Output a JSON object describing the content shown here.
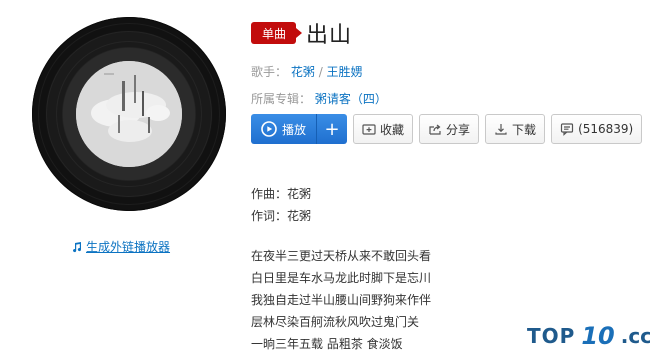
{
  "song": {
    "badge": "单曲",
    "title": "出山",
    "singer_label": "歌手：",
    "singers": [
      "花粥",
      "王胜娚"
    ],
    "album_label": "所属专辑：",
    "album": "粥请客（四）"
  },
  "actions": {
    "play": "播放",
    "add": "+",
    "collect": "收藏",
    "share": "分享",
    "download": "下载",
    "comments": "(516839)"
  },
  "left": {
    "player_link": "生成外链播放器"
  },
  "lyrics": {
    "composer": "作曲：花粥",
    "lyricist": "作词：花粥",
    "lines": [
      "在夜半三更过天桥从来不敢回头看",
      "白日里是车水马龙此时脚下是忘川",
      "我独自走过半山腰山间野狗来作伴",
      "层林尽染百舸流秋风吹过鬼门关",
      "一晌三年五载 品粗茶 食淡饭"
    ]
  },
  "watermark": {
    "top": "TOP",
    "num": "10",
    "tld": ".cc"
  },
  "colors": {
    "accent_blue": "#0c73c2",
    "badge_red": "#c20c0c",
    "play_blue": "#1f6fcf"
  }
}
